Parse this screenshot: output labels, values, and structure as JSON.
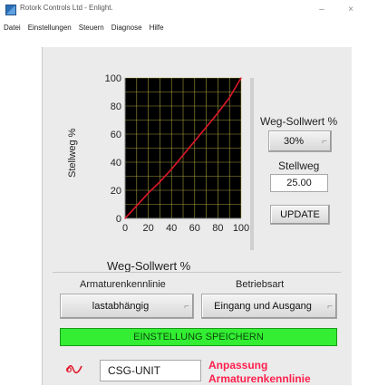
{
  "window": {
    "title": "Rotork Controls Ltd - Enlight.",
    "min": "–",
    "close": "×"
  },
  "menu": [
    "Datei",
    "Einstellungen",
    "Steuern",
    "Diagnose",
    "Hilfe"
  ],
  "chart_data": {
    "type": "line",
    "xlabel": "Weg-Sollwert %",
    "ylabel": "Stellweg %",
    "xlim": [
      0,
      100
    ],
    "ylim": [
      0,
      100
    ],
    "x_ticks": [
      "0",
      "20",
      "40",
      "60",
      "80",
      "100"
    ],
    "y_ticks": [
      "0",
      "20",
      "40",
      "60",
      "80",
      "100"
    ],
    "grid": true,
    "series": [
      {
        "color": "#e0182a",
        "x": [
          0,
          10,
          20,
          30,
          40,
          50,
          60,
          70,
          80,
          90,
          100
        ],
        "y": [
          0,
          9,
          18,
          26,
          35,
          45,
          55,
          65,
          75,
          86,
          100
        ]
      }
    ],
    "grid_color": "#c9c24a",
    "background": "#000000"
  },
  "controls": {
    "setpoint_label": "Weg-Sollwert %",
    "setpoint_value": "30%",
    "stellweg_label": "Stellweg",
    "stellweg_value": "25.00",
    "update_label": "UPDATE",
    "characteristic_label": "Armaturenkennlinie",
    "characteristic_value": "lastabhängig",
    "mode_label": "Betriebsart",
    "mode_value": "Eingang und Ausgang",
    "save_label": "EINSTELLUNG SPEICHERN",
    "unit_value": "CSG-UNIT",
    "adjust_line1": "Anpassung",
    "adjust_line2": "Armaturenkennlinie"
  }
}
